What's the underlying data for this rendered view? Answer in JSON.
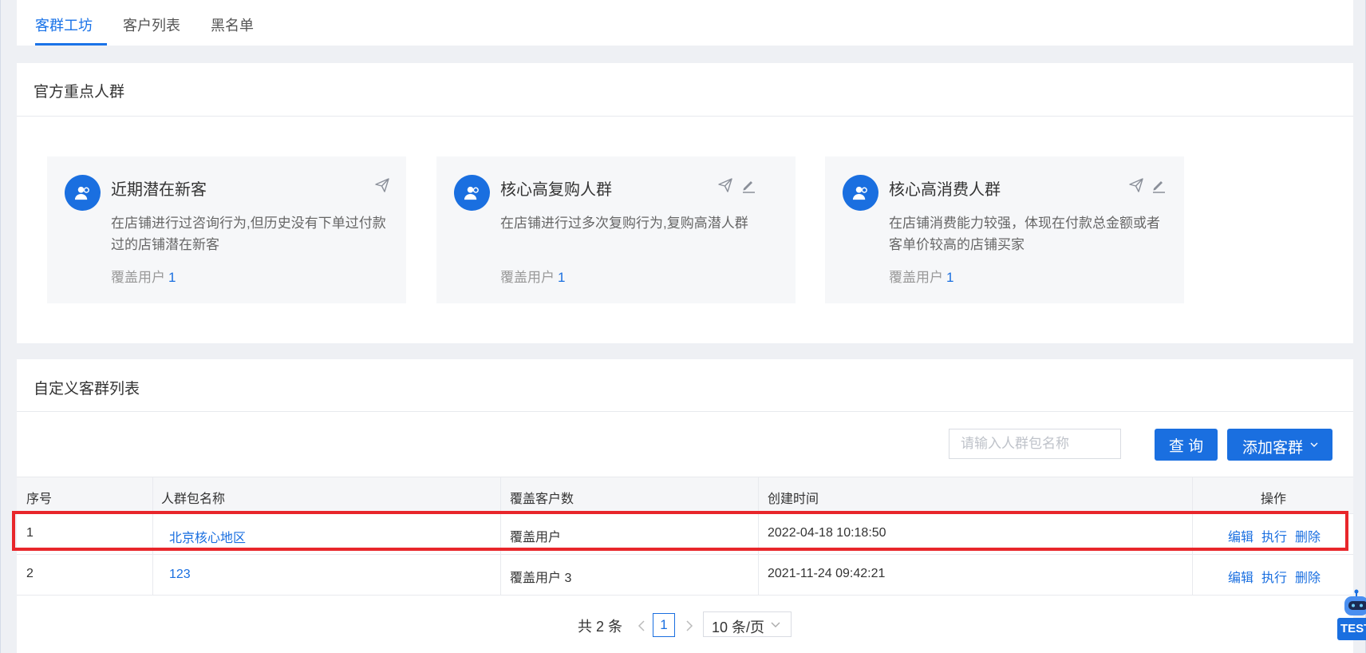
{
  "tabs": [
    {
      "label": "客群工坊",
      "active": true
    },
    {
      "label": "客户列表",
      "active": false
    },
    {
      "label": "黑名单",
      "active": false
    }
  ],
  "official_section": {
    "title": "官方重点人群",
    "cards": [
      {
        "title": "近期潜在新客",
        "description": "在店铺进行过咨询行为,但历史没有下单过付款过的店铺潜在新客",
        "coverage_label": "覆盖用户",
        "coverage_count": "1",
        "actions": [
          "send-icon"
        ]
      },
      {
        "title": "核心高复购人群",
        "description": "在店铺进行过多次复购行为,复购高潜人群",
        "coverage_label": "覆盖用户",
        "coverage_count": "1",
        "actions": [
          "send-icon",
          "edit-icon"
        ]
      },
      {
        "title": "核心高消费人群",
        "description": "在店铺消费能力较强，体现在付款总金额或者客单价较高的店铺买家",
        "coverage_label": "覆盖用户",
        "coverage_count": "1",
        "actions": [
          "send-icon",
          "edit-icon"
        ]
      }
    ]
  },
  "custom_section": {
    "title": "自定义客群列表",
    "search": {
      "placeholder": "请输入人群包名称",
      "value": ""
    },
    "query_button": "查 询",
    "add_button": "添加客群",
    "table": {
      "columns": [
        "序号",
        "人群包名称",
        "覆盖客户数",
        "创建时间",
        "操作"
      ],
      "rows": [
        {
          "index": "1",
          "name": "北京核心地区",
          "coverage": "覆盖用户",
          "created": "2022-04-18 10:18:50",
          "highlighted": true
        },
        {
          "index": "2",
          "name": "123",
          "coverage": "覆盖用户 3",
          "created": "2021-11-24 09:42:21",
          "highlighted": false
        }
      ],
      "actions": [
        "编辑",
        "执行",
        "删除"
      ]
    },
    "pagination": {
      "total": "共 2 条",
      "current_page": "1",
      "page_size": "10 条/页"
    }
  },
  "robot_widget": {
    "label": "TEST"
  },
  "colors": {
    "primary": "#1a6fe0",
    "highlight_border": "#e8262b",
    "background": "#eef0f4"
  }
}
